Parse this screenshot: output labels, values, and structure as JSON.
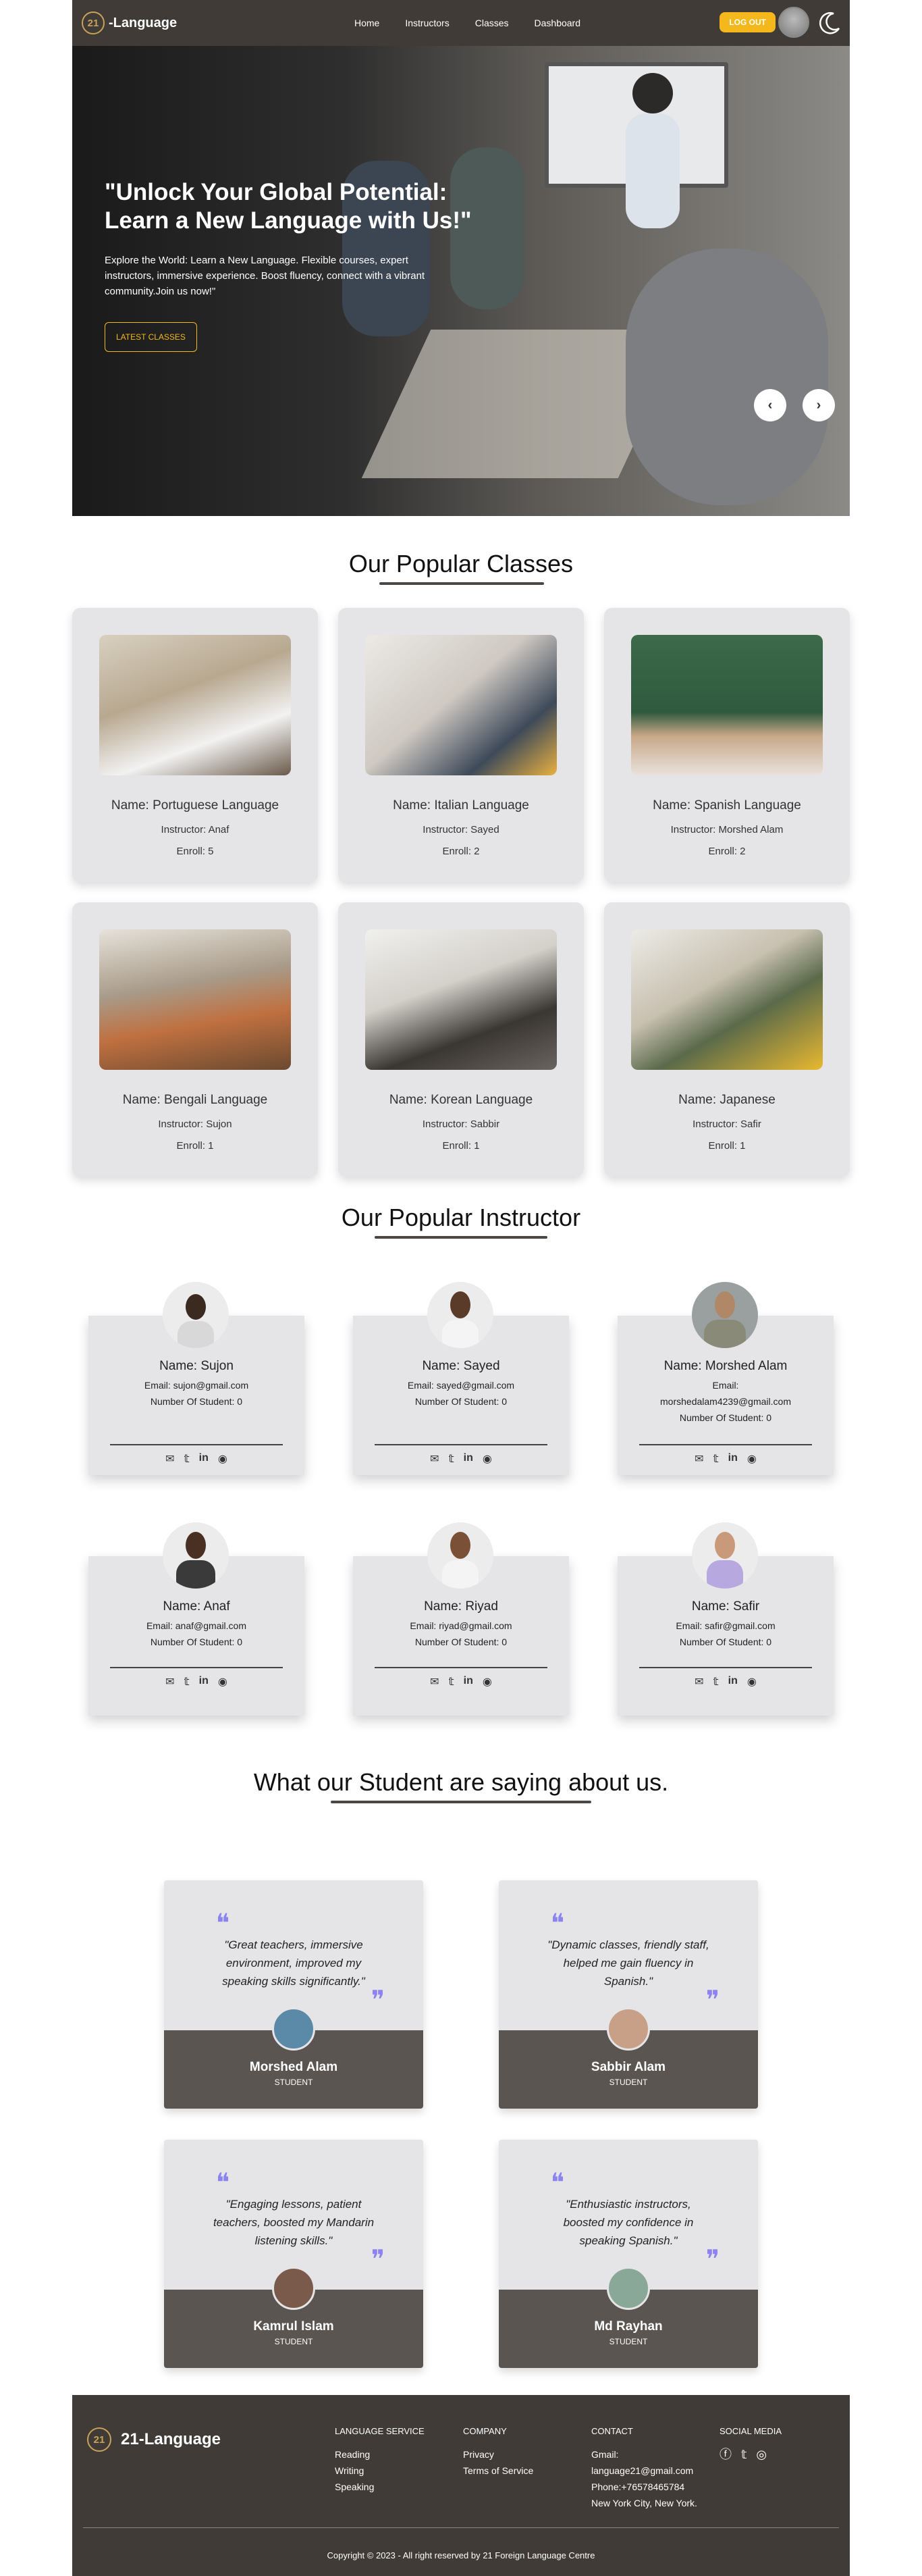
{
  "nav": {
    "logo_mark": "21",
    "logo_text": "-Language",
    "links": [
      "Home",
      "Instructors",
      "Classes",
      "Dashboard"
    ],
    "logout": "LOG OUT"
  },
  "hero": {
    "title": "\"Unlock Your Global Potential: Learn a New Language with Us!\"",
    "subtitle": "Explore the World: Learn a New Language. Flexible courses, expert instructors, immersive experience. Boost fluency, connect with a vibrant community.Join us now!\"",
    "button": "LATEST CLASSES",
    "prev": "‹",
    "next": "›"
  },
  "classes": {
    "heading": "Our Popular Classes",
    "items": [
      {
        "name": "Name: Portuguese Language",
        "instructor": "Instructor: Anaf",
        "enroll": "Enroll: 5"
      },
      {
        "name": "Name: Italian Language",
        "instructor": "Instructor: Sayed",
        "enroll": "Enroll: 2"
      },
      {
        "name": "Name: Spanish Language",
        "instructor": "Instructor: Morshed Alam",
        "enroll": "Enroll: 2"
      },
      {
        "name": "Name: Bengali Language",
        "instructor": "Instructor: Sujon",
        "enroll": "Enroll: 1"
      },
      {
        "name": "Name: Korean Language",
        "instructor": "Instructor: Sabbir",
        "enroll": "Enroll: 1"
      },
      {
        "name": "Name: Japanese",
        "instructor": "Instructor: Safir",
        "enroll": "Enroll: 1"
      }
    ]
  },
  "instructors": {
    "heading": "Our Popular Instructor",
    "items": [
      {
        "name": "Name: Sujon",
        "email": "Email: sujon@gmail.com",
        "students": "Number Of Student: 0"
      },
      {
        "name": "Name: Sayed",
        "email": "Email: sayed@gmail.com",
        "students": "Number Of Student: 0"
      },
      {
        "name": "Name: Morshed Alam",
        "email_label": "Email:",
        "email": "morshedalam4239@gmail.com",
        "students": "Number Of Student: 0"
      },
      {
        "name": "Name: Anaf",
        "email": "Email: anaf@gmail.com",
        "students": "Number Of Student: 0"
      },
      {
        "name": "Name: Riyad",
        "email": "Email: riyad@gmail.com",
        "students": "Number Of Student: 0"
      },
      {
        "name": "Name: Safir",
        "email": "Email: safir@gmail.com",
        "students": "Number Of Student: 0"
      }
    ]
  },
  "testimonials": {
    "heading": "What our Student are saying about us.",
    "items": [
      {
        "quote": "\"Great teachers, immersive environment, improved my speaking skills significantly.\"",
        "name": "Morshed Alam",
        "role": "STUDENT"
      },
      {
        "quote": "\"Dynamic classes, friendly staff, helped me gain fluency in Spanish.\"",
        "name": "Sabbir Alam",
        "role": "STUDENT"
      },
      {
        "quote": "\"Engaging lessons, patient teachers, boosted my Mandarin listening skills.\"",
        "name": "Kamrul Islam",
        "role": "STUDENT"
      },
      {
        "quote": "\"Enthusiastic instructors, boosted my confidence in speaking Spanish.\"",
        "name": "Md Rayhan",
        "role": "STUDENT"
      }
    ]
  },
  "footer": {
    "logo_mark": "21",
    "logo_text": "21-Language",
    "service_head": "LANGUAGE SERVICE",
    "service": [
      "Reading",
      "Writing",
      "Speaking"
    ],
    "company_head": "COMPANY",
    "company": [
      "Privacy",
      "Terms of Service"
    ],
    "contact_head": "CONTACT",
    "contact": [
      "Gmail:",
      "language21@gmail.com",
      "Phone:+76578465784",
      "New York City, New York."
    ],
    "social_head": "SOCIAL MEDIA",
    "copyright": "Copyright © 2023 - All right reserved by 21 Foreign Language Centre"
  },
  "colors": {
    "accent": "#f5b81c",
    "dark": "#403b36",
    "card": "#e5e5e8",
    "quote": "#8b83f3"
  }
}
